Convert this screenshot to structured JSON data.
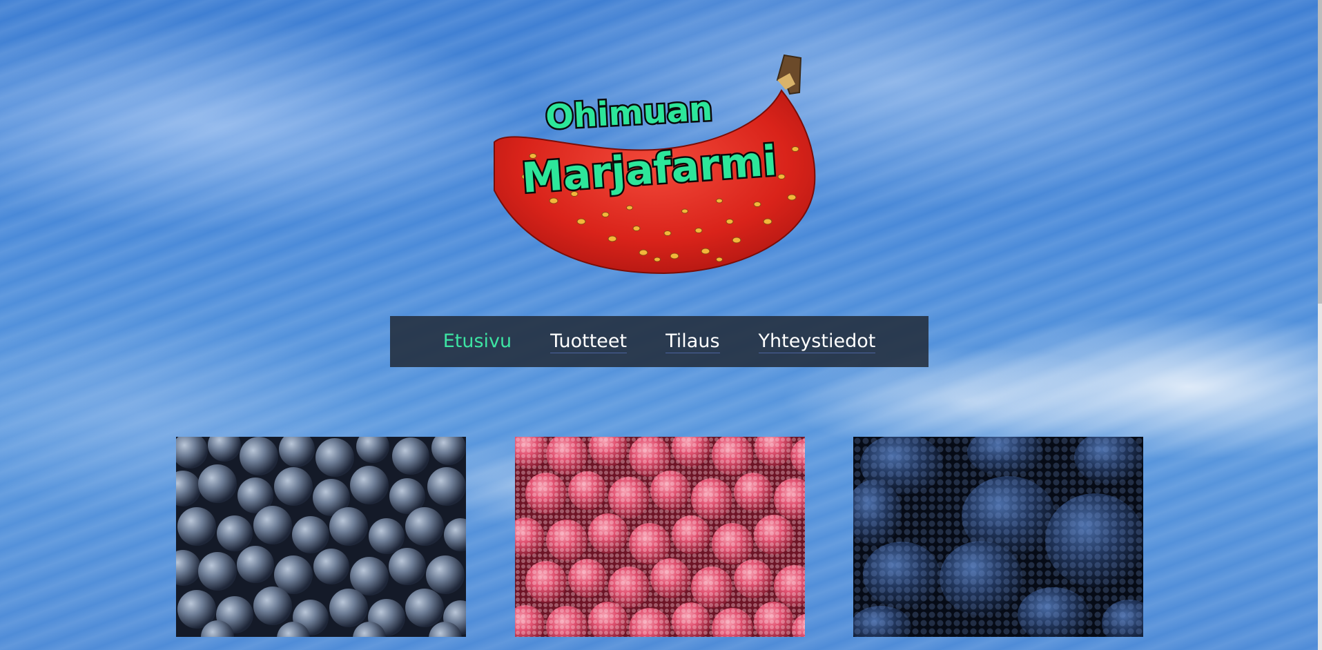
{
  "brand": {
    "logo_line1": "Ohimuan",
    "logo_line2": "Marjafarmi"
  },
  "nav": {
    "items": [
      {
        "label": "Etusivu",
        "active": true
      },
      {
        "label": "Tuotteet",
        "active": false
      },
      {
        "label": "Tilaus",
        "active": false
      },
      {
        "label": "Yhteystiedot",
        "active": false
      }
    ]
  },
  "gallery": [
    {
      "name": "blueberries",
      "icon": "blueberry-photo"
    },
    {
      "name": "raspberries",
      "icon": "raspberry-photo"
    },
    {
      "name": "blackberries",
      "icon": "blackberry-photo"
    }
  ],
  "colors": {
    "nav_active": "#3de4a3",
    "nav_text": "#ffffff",
    "logo_text": "#2de69a",
    "banana_red": "#e4271d"
  }
}
